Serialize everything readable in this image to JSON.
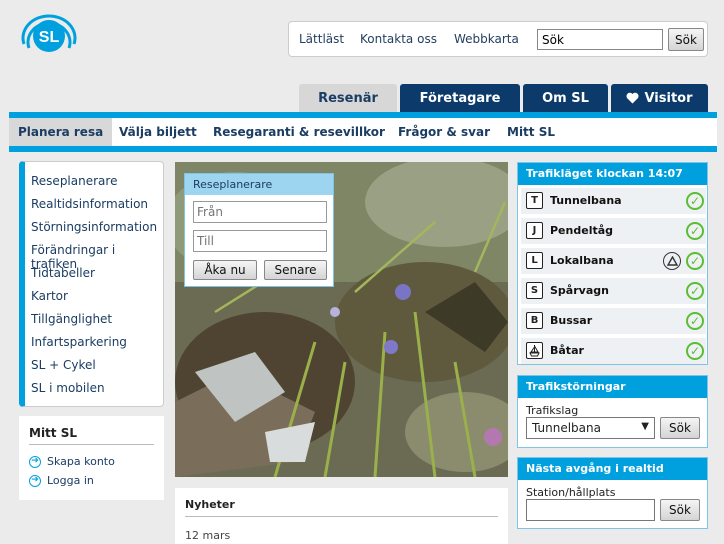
{
  "header": {
    "utility_links": [
      "Lättläst",
      "Kontakta oss",
      "Webbkarta"
    ],
    "search": {
      "value": "Sök",
      "button": "Sök"
    }
  },
  "tabs": [
    "Resenär",
    "Företagare",
    "Om SL",
    "Visitor"
  ],
  "subnav": [
    "Planera resa",
    "Välja biljett",
    "Resegaranti & resevillkor",
    "Frågor & svar",
    "Mitt SL"
  ],
  "sidebar": {
    "items": [
      "Reseplanerare",
      "Realtidsinformation",
      "Störningsinformation",
      "Förändringar i trafiken",
      "Tidtabeller",
      "Kartor",
      "Tillgänglighet",
      "Infartsparkering",
      "SL + Cykel",
      "SL i mobilen"
    ]
  },
  "mitt_sl": {
    "title": "Mitt SL",
    "links": [
      "Skapa konto",
      "Logga in"
    ]
  },
  "planner": {
    "title": "Reseplanerare",
    "from_placeholder": "Från",
    "to_placeholder": "Till",
    "go_now": "Åka nu",
    "later": "Senare"
  },
  "news": {
    "title": "Nyheter",
    "date": "12 mars"
  },
  "traffic_status": {
    "title": "Trafikläget klockan 14:07",
    "rows": [
      {
        "mode": "Tunnelbana",
        "letter": "T",
        "status": "ok"
      },
      {
        "mode": "Pendeltåg",
        "letter": "J",
        "status": "ok"
      },
      {
        "mode": "Lokalbana",
        "letter": "L",
        "status": "warning+ok"
      },
      {
        "mode": "Spårvagn",
        "letter": "S",
        "status": "ok"
      },
      {
        "mode": "Bussar",
        "letter": "B",
        "status": "ok"
      },
      {
        "mode": "Båtar",
        "letter": "",
        "status": "ok"
      }
    ]
  },
  "disruptions": {
    "title": "Trafikstörningar",
    "label": "Trafikslag",
    "selected": "Tunnelbana",
    "button": "Sök"
  },
  "next_departure": {
    "title": "Nästa avgång i realtid",
    "label": "Station/hållplats",
    "button": "Sök"
  },
  "colors": {
    "brand_blue": "#00a0df",
    "navy": "#0b3a6b",
    "ok_green": "#5bbd33"
  }
}
